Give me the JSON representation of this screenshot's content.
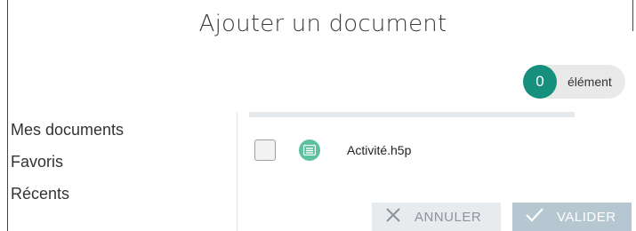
{
  "dialog": {
    "title": "Ajouter un document",
    "counter": {
      "count": "0",
      "label": "élément"
    }
  },
  "sidebar": {
    "items": [
      {
        "label": "Mes documents"
      },
      {
        "label": "Favoris"
      },
      {
        "label": "Récents"
      }
    ]
  },
  "files": [
    {
      "name": "Activité.h5p",
      "icon": "document-icon",
      "checked": false
    }
  ],
  "actions": {
    "cancel_label": "ANNULER",
    "cancel_icon": "close-icon",
    "validate_label": "VALIDER",
    "validate_icon": "check-icon"
  },
  "colors": {
    "accent": "#16907c",
    "file_icon": "#5ec29e",
    "validate_bg": "#b7c7d2",
    "cancel_bg": "#e8ebee"
  }
}
